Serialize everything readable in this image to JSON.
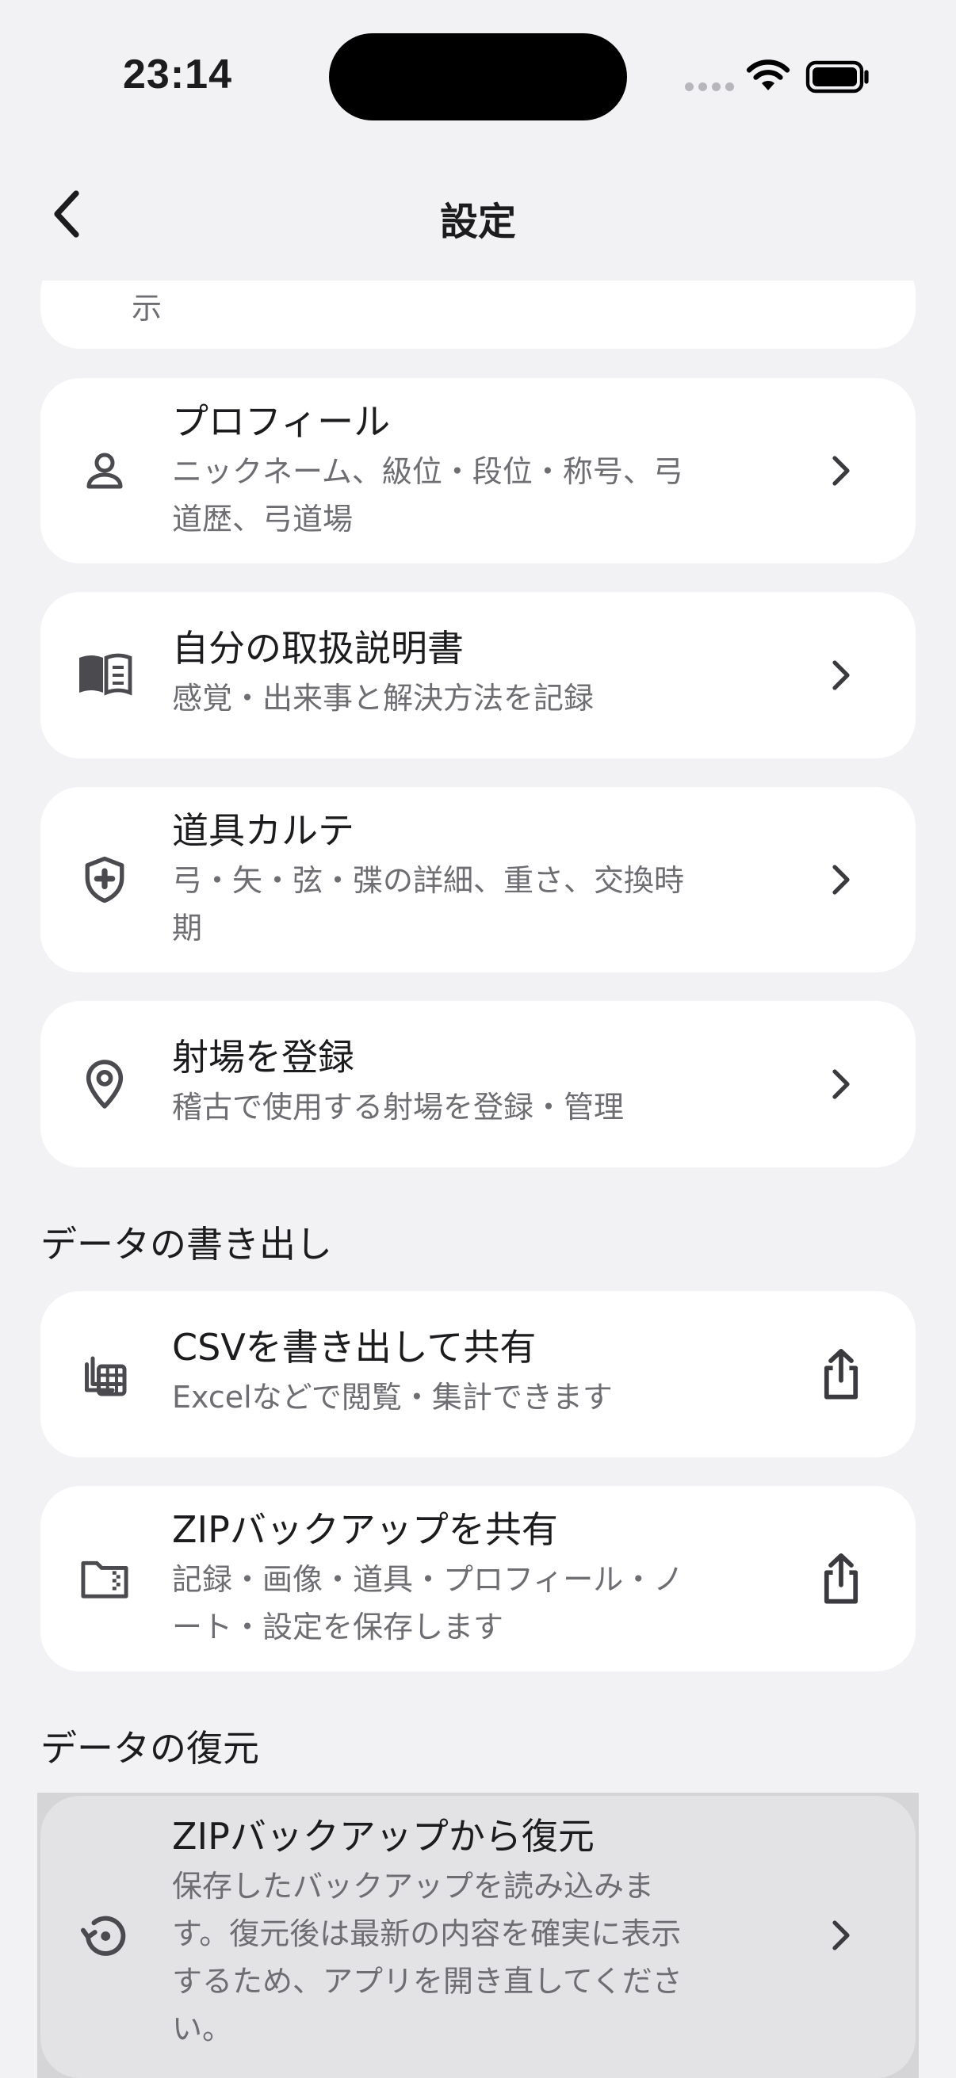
{
  "status": {
    "time": "23:14"
  },
  "nav": {
    "title": "設定"
  },
  "partial_card": {
    "subtitle_tail": "示"
  },
  "settings": [
    {
      "title": "プロフィール",
      "subtitle_lines": [
        "ニックネーム、級位・段位・称号、弓",
        "道歴、弓道場"
      ],
      "icon": "person-icon",
      "trail": "chevron-right-icon"
    },
    {
      "title": "自分の取扱説明書",
      "subtitle_lines": [
        "感覚・出来事と解決方法を記録"
      ],
      "icon": "book-icon",
      "trail": "chevron-right-icon"
    },
    {
      "title": "道具カルテ",
      "subtitle_lines": [
        "弓・矢・弦・弽の詳細、重さ、交換時",
        "期"
      ],
      "icon": "shield-icon",
      "trail": "chevron-right-icon"
    },
    {
      "title": "射場を登録",
      "subtitle_lines": [
        "稽古で使用する射場を登録・管理"
      ],
      "icon": "location-pin-icon",
      "trail": "chevron-right-icon"
    }
  ],
  "export_section": {
    "header": "データの書き出し",
    "items": [
      {
        "title": "CSVを書き出して共有",
        "subtitle_lines": [
          "Excelなどで閲覧・集計できます"
        ],
        "icon": "spreadsheet-icon",
        "trail": "share-icon"
      },
      {
        "title": "ZIPバックアップを共有",
        "subtitle_lines": [
          "記録・画像・道具・プロフィール・ノ",
          "ート・設定を保存します"
        ],
        "icon": "zip-folder-icon",
        "trail": "share-icon"
      }
    ]
  },
  "restore_section": {
    "header": "データの復元",
    "items": [
      {
        "title": "ZIPバックアップから復元",
        "subtitle_lines": [
          "保存したバックアップを読み込みま",
          "す。復元後は最新の内容を確実に表示",
          "するため、アプリを開き直してくださ",
          "い。"
        ],
        "icon": "restore-icon",
        "trail": "chevron-right-icon"
      }
    ]
  }
}
